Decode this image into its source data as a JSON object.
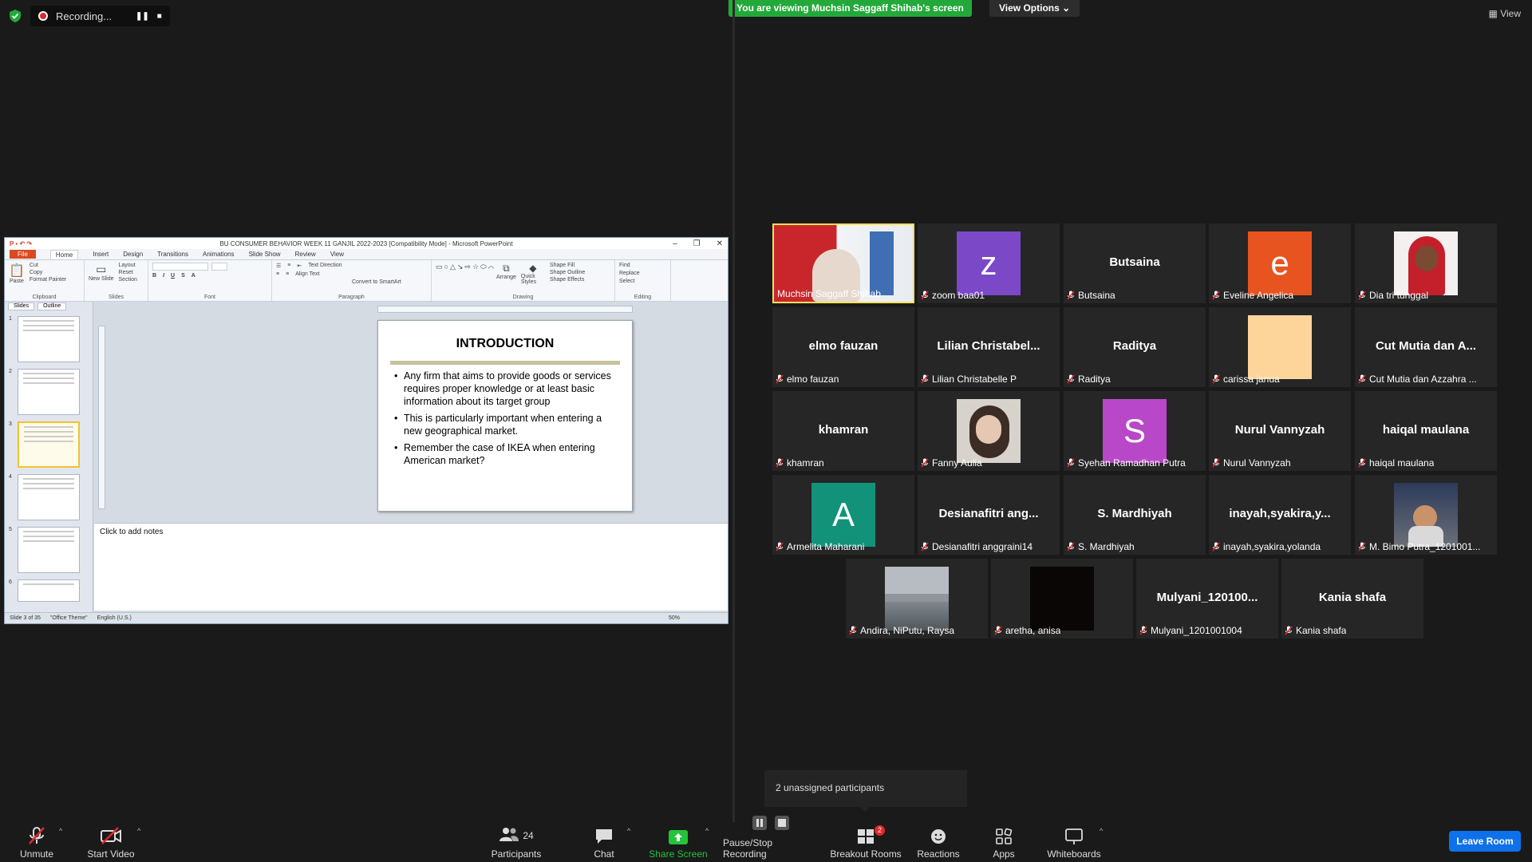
{
  "recording": {
    "label": "Recording..."
  },
  "banner": {
    "viewing": "You are viewing Muchsin Saggaff Shihab's screen",
    "view_options": "View Options",
    "view": "View"
  },
  "ppt": {
    "title": "BU CONSUMER BEHAVIOR WEEK 11 GANJIL 2022-2023 [Compatibility Mode] - Microsoft PowerPoint",
    "tabs": [
      "File",
      "Home",
      "Insert",
      "Design",
      "Transitions",
      "Animations",
      "Slide Show",
      "Review",
      "View"
    ],
    "ribbon": {
      "clipboard": {
        "paste": "Paste",
        "cut": "Cut",
        "copy": "Copy",
        "format_painter": "Format Painter",
        "label": "Clipboard"
      },
      "slides": {
        "new_slide": "New Slide",
        "layout": "Layout",
        "reset": "Reset",
        "section": "Section",
        "label": "Slides"
      },
      "font": {
        "label": "Font"
      },
      "paragraph": {
        "text_direction": "Text Direction",
        "align_text": "Align Text",
        "smartart": "Convert to SmartArt",
        "label": "Paragraph"
      },
      "drawing": {
        "arrange": "Arrange",
        "quick_styles": "Quick Styles",
        "shape_fill": "Shape Fill",
        "shape_outline": "Shape Outline",
        "shape_effects": "Shape Effects",
        "label": "Drawing"
      },
      "editing": {
        "find": "Find",
        "replace": "Replace",
        "select": "Select",
        "label": "Editing"
      }
    },
    "pane_tabs": {
      "slides": "Slides",
      "outline": "Outline"
    },
    "thumb_numbers": [
      "1",
      "2",
      "3",
      "4",
      "5",
      "6"
    ],
    "slide": {
      "title": "INTRODUCTION",
      "bullets": [
        "Any firm that aims to provide goods or services requires proper knowledge or at least basic information about its target group",
        "This is particularly important when entering a new geographical market.",
        "Remember the case of IKEA when entering American market?"
      ]
    },
    "notes": "Click to add notes",
    "status": {
      "slide": "Slide 3 of 35",
      "theme": "\"Office Theme\"",
      "language": "English (U.S.)",
      "zoom": "50%"
    }
  },
  "participants_tiles": [
    {
      "name": "",
      "label": "Muchsin Saggaff Shihab"
    },
    {
      "name": "",
      "label": "zoom baa01",
      "avatar": "z",
      "avatar_color": "#7b48c8"
    },
    {
      "name": "Butsaina",
      "label": "Butsaina"
    },
    {
      "name": "",
      "label": "Eveline Angelica",
      "avatar": "e",
      "avatar_color": "#e85420"
    },
    {
      "name": "",
      "label": "Dia tri tunggal"
    },
    {
      "name": "elmo fauzan",
      "label": "elmo fauzan"
    },
    {
      "name": "Lilian  Christabel...",
      "label": "Lilian Christabelle P"
    },
    {
      "name": "Raditya",
      "label": "Raditya"
    },
    {
      "name": "",
      "label": "carissa janua",
      "avatar": "",
      "avatar_color": "#fdd59a"
    },
    {
      "name": "Cut Mutia dan A...",
      "label": "Cut Mutia dan Azzahra ..."
    },
    {
      "name": "khamran",
      "label": "khamran"
    },
    {
      "name": "",
      "label": "Fanny Aulia"
    },
    {
      "name": "",
      "label": "Syehan Ramadhan Putra",
      "avatar": "S",
      "avatar_color": "#b848c8"
    },
    {
      "name": "Nurul Vannyzah",
      "label": "Nurul Vannyzah"
    },
    {
      "name": "haiqal maulana",
      "label": "haiqal maulana"
    },
    {
      "name": "",
      "label": "Armelita Maharani",
      "avatar": "A",
      "avatar_color": "#13927a"
    },
    {
      "name": "Desianafitri  ang...",
      "label": "Desianafitri anggraini14"
    },
    {
      "name": "S. Mardhiyah",
      "label": "S. Mardhiyah"
    },
    {
      "name": "inayah,syakira,y...",
      "label": "inayah,syakira,yolanda"
    },
    {
      "name": "",
      "label": "M. Bimo Putra_1201001..."
    },
    {
      "name": "",
      "label": "Andira, NiPutu, Raysa"
    },
    {
      "name": "",
      "label": "aretha, anisa"
    },
    {
      "name": "Mulyani_120100...",
      "label": "Mulyani_1201001004"
    },
    {
      "name": "Kania shafa",
      "label": "Kania shafa"
    }
  ],
  "unassigned": "2 unassigned participants",
  "toolbar": {
    "unmute": "Unmute",
    "start_video": "Start Video",
    "participants": "Participants",
    "participants_count": "24",
    "chat": "Chat",
    "share_screen": "Share Screen",
    "pause_stop": "Pause/Stop Recording",
    "breakout": "Breakout Rooms",
    "breakout_badge": "2",
    "reactions": "Reactions",
    "apps": "Apps",
    "whiteboards": "Whiteboards",
    "leave": "Leave Room"
  }
}
